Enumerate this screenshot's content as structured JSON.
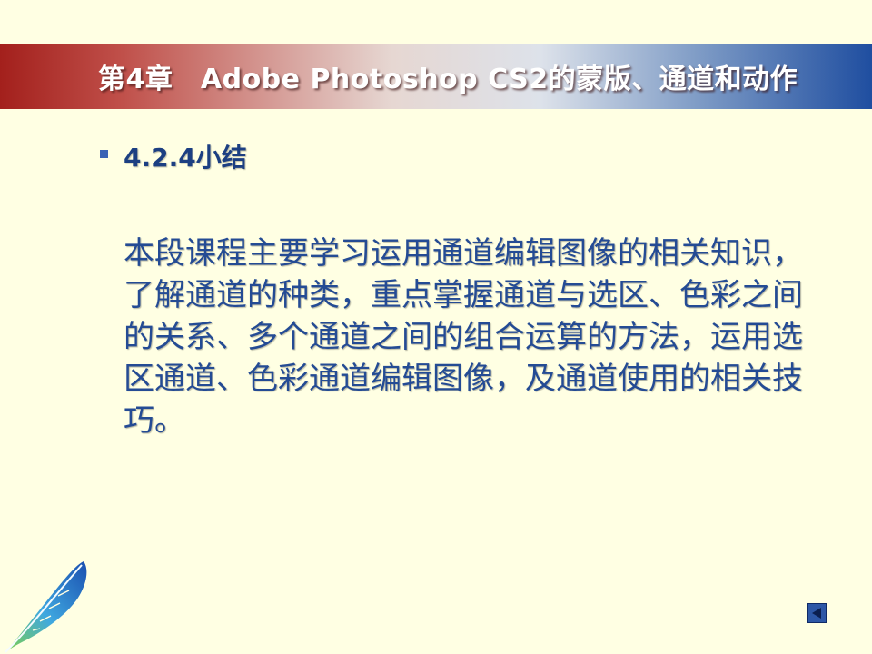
{
  "header": {
    "title": "第4章　Adobe Photoshop CS2的蒙版、通道和动作"
  },
  "section": {
    "heading": "4.2.4小结"
  },
  "content": {
    "summary": "本段课程主要学习运用通道编辑图像的相关知识，了解通道的种类，重点掌握通道与选区、色彩之间的关系、多个通道之间的组合运算的方法，运用选区通道、色彩通道编辑图像，及通道使用的相关技巧。"
  },
  "icons": {
    "logo": "feather-icon",
    "prev": "triangle-left-icon"
  },
  "colors": {
    "background": "#ffffe3",
    "heading": "#1c3f82",
    "body_text": "#244b94",
    "banner_left": "#a3201c",
    "banner_right": "#1f4ea0"
  }
}
